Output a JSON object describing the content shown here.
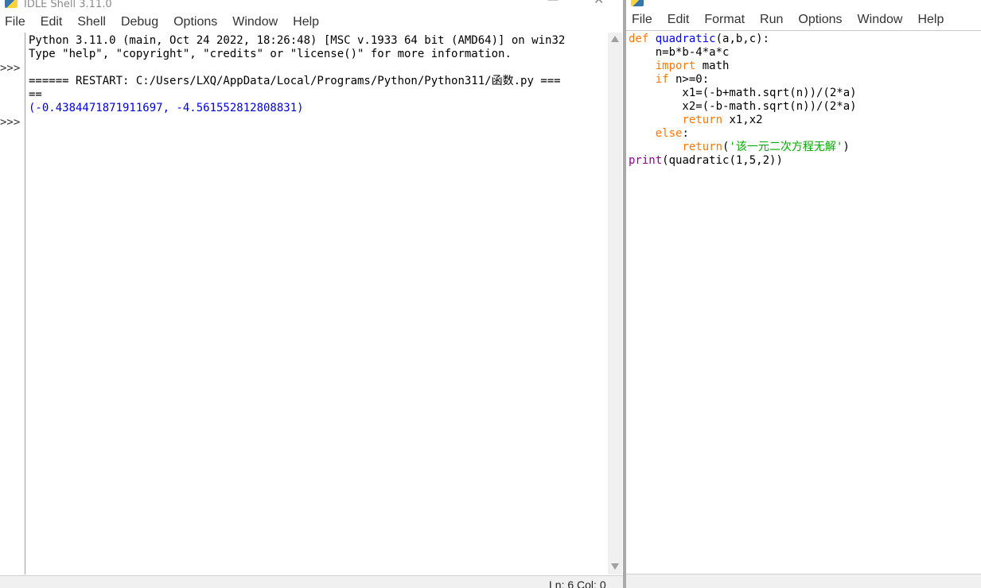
{
  "shell": {
    "title": "IDLE Shell 3.11.0",
    "menu": [
      "File",
      "Edit",
      "Shell",
      "Debug",
      "Options",
      "Window",
      "Help"
    ],
    "prompt": ">>>",
    "lines": [
      "Python 3.11.0 (main, Oct 24 2022, 18:26:48) [MSC v.1933 64 bit (AMD64)] on win32",
      "Type \"help\", \"copyright\", \"credits\" or \"license()\" for more information.",
      "",
      "====== RESTART: C:/Users/LXQ/AppData/Local/Programs/Python/Python311/函数.py ===",
      "=="
    ],
    "output": "(-0.4384471871911697, -4.561552812808831)",
    "status": "Ln: 6   Col: 0"
  },
  "editor": {
    "menu": [
      "File",
      "Edit",
      "Format",
      "Run",
      "Options",
      "Window",
      "Help"
    ],
    "code": {
      "l1_kw": "def",
      "l1_fn": "quadratic",
      "l1_rest": "(a,b,c):",
      "l2": "    n=b*b-4*a*c",
      "l3_kw": "import",
      "l3_rest": " math",
      "l4_kw": "if",
      "l4_rest": " n>=0:",
      "l5": "        x1=(-b+math.sqrt(n))/(2*a)",
      "l6": "        x2=(-b-math.sqrt(n))/(2*a)",
      "l7_kw": "return",
      "l7_rest": " x1,x2",
      "l8_kw": "else",
      "l8_rest": ":",
      "l9_kw": "return",
      "l9_p1": "(",
      "l9_str": "'该一元二次方程无解'",
      "l9_p2": ")",
      "l10_bi": "print",
      "l10_rest": "(quadratic(1,5,2))"
    }
  }
}
